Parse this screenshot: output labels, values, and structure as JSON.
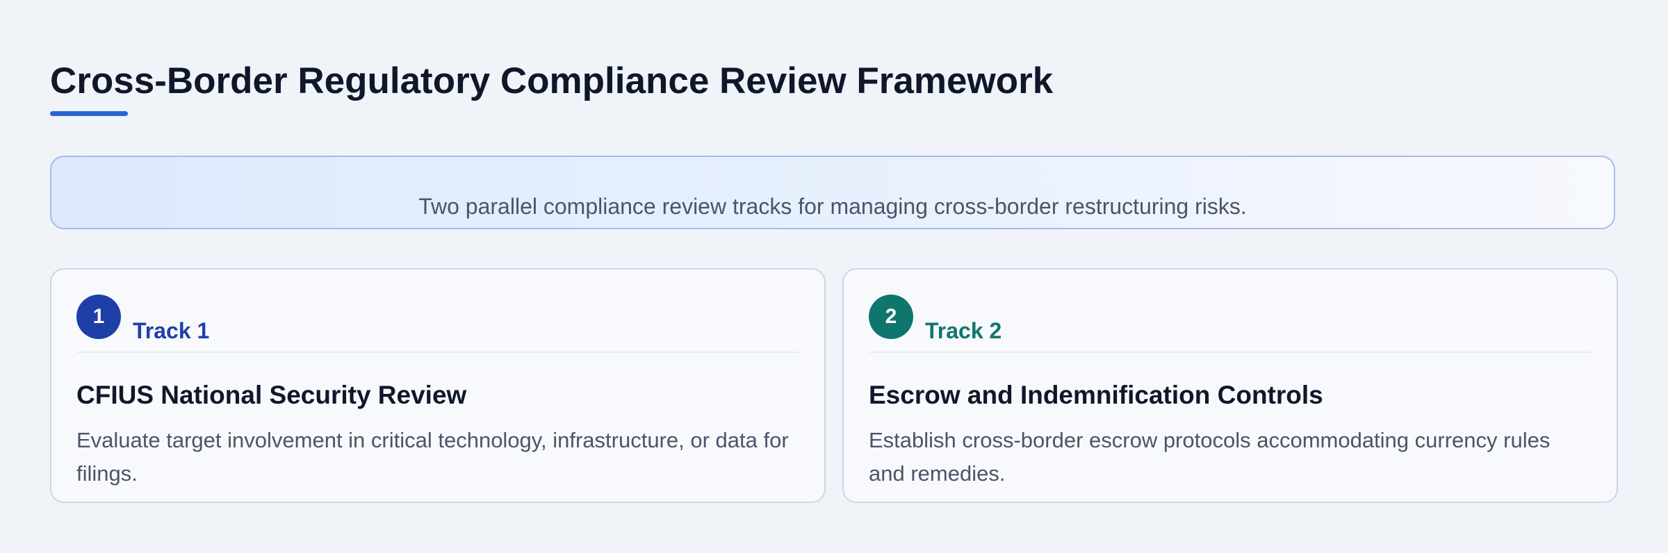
{
  "page": {
    "title": "Cross-Border Regulatory Compliance Review Framework"
  },
  "banner": {
    "text": "Two parallel compliance review tracks for managing cross-border restructuring risks."
  },
  "tracks": [
    {
      "number": "1",
      "label": "Track 1",
      "title": "CFIUS National Security Review",
      "description": "Evaluate target involvement in critical technology, infrastructure, or data for filings.",
      "accent_color": "#1f3fa8"
    },
    {
      "number": "2",
      "label": "Track 2",
      "title": "Escrow and Indemnification Controls",
      "description": "Establish cross-border escrow protocols accommodating currency rules and remedies.",
      "accent_color": "#0f766e"
    }
  ],
  "colors": {
    "title_underline": "#2a63d8",
    "background": "#f0f4f9"
  }
}
